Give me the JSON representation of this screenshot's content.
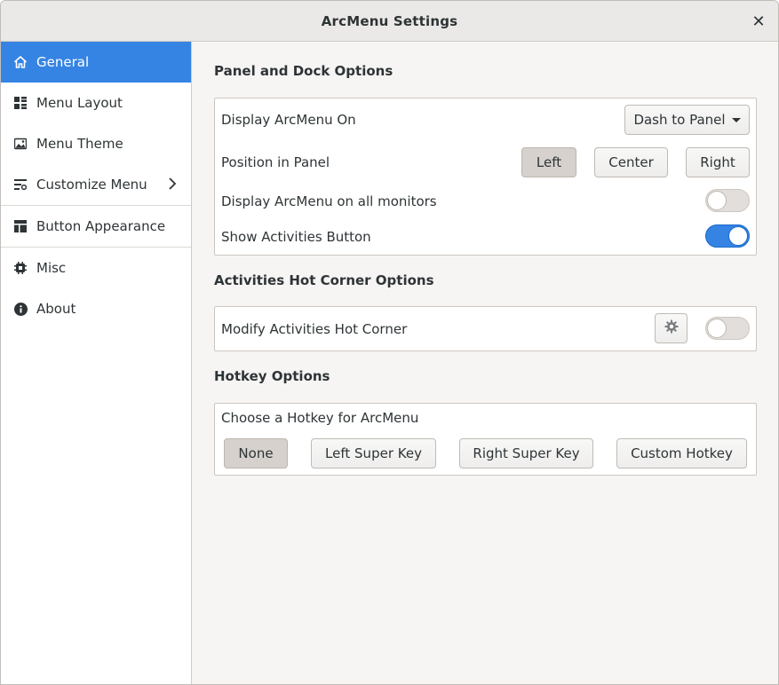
{
  "window": {
    "title": "ArcMenu Settings",
    "close_glyph": "✕"
  },
  "sidebar": {
    "items": [
      {
        "label": "General",
        "icon": "home-icon"
      },
      {
        "label": "Menu Layout",
        "icon": "layout-icon"
      },
      {
        "label": "Menu Theme",
        "icon": "theme-icon"
      },
      {
        "label": "Customize Menu",
        "icon": "customize-icon"
      },
      {
        "label": "Button Appearance",
        "icon": "button-appearance-icon"
      },
      {
        "label": "Misc",
        "icon": "misc-icon"
      },
      {
        "label": "About",
        "icon": "info-icon"
      }
    ]
  },
  "panel_dock": {
    "title": "Panel and Dock Options",
    "display_on_label": "Display ArcMenu On",
    "display_on_value": "Dash to Panel",
    "position_label": "Position in Panel",
    "position_options": [
      "Left",
      "Center",
      "Right"
    ],
    "all_monitors_label": "Display ArcMenu on all monitors",
    "all_monitors_on": false,
    "activities_label": "Show Activities Button",
    "activities_on": true
  },
  "hot_corner": {
    "title": "Activities Hot Corner Options",
    "modify_label": "Modify Activities Hot Corner",
    "modify_on": false
  },
  "hotkey": {
    "title": "Hotkey Options",
    "choose_label": "Choose a Hotkey for ArcMenu",
    "options": [
      "None",
      "Left Super Key",
      "Right Super Key",
      "Custom Hotkey"
    ]
  },
  "colors": {
    "accent": "#3584e4",
    "sidebar_bg": "#ffffff",
    "content_bg": "#f6f5f4"
  }
}
